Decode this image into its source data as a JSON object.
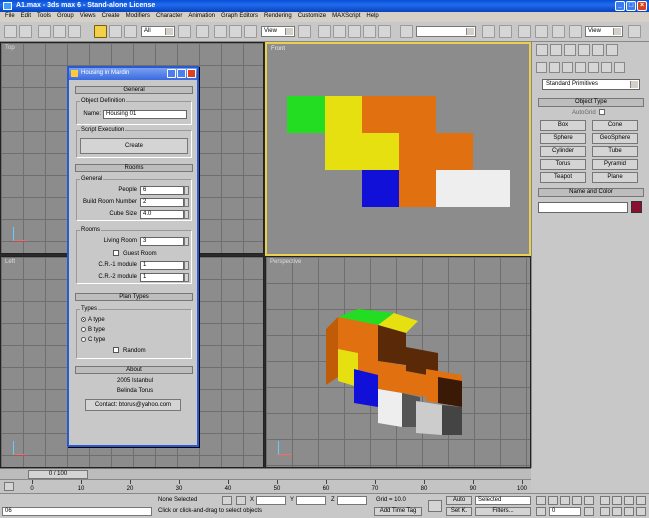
{
  "window": {
    "title": "A1.max - 3ds max 6 - Stand-alone License"
  },
  "menu": [
    "File",
    "Edit",
    "Tools",
    "Group",
    "Views",
    "Create",
    "Modifiers",
    "Character",
    "Animation",
    "Graph Editors",
    "Rendering",
    "Customize",
    "MAXScript",
    "Help"
  ],
  "toolbar": {
    "selection_filter": "All",
    "ref_coord_1": "View",
    "ref_coord_2": "View"
  },
  "viewports": {
    "top": {
      "label": "Top"
    },
    "front": {
      "label": "Front"
    },
    "left": {
      "label": "Left"
    },
    "perspective": {
      "label": "Perspective"
    }
  },
  "colors": {
    "green": "#22dd22",
    "yellow": "#e6e010",
    "orange": "#e07010",
    "blue": "#1010d8",
    "white": "#eeeeee",
    "active_border": "#e8d050"
  },
  "dialog": {
    "title": "Housing in Mardin",
    "general_header": "General",
    "object_definition_title": "Object Definition",
    "name_label": "Name:",
    "name_value": "Housing 01",
    "script_execution_title": "Script Execution",
    "create_button": "Create",
    "rooms_header": "Rooms",
    "general_group_title": "General",
    "people_label": "People",
    "people_value": "6",
    "build_room_label": "Build Room Number",
    "build_room_value": "2",
    "cube_size_label": "Cube Size",
    "cube_size_value": "4.0",
    "rooms_group_title": "Rooms",
    "living_room_label": "Living Room",
    "living_room_value": "3",
    "guest_room_label": "Guest Room",
    "cr1_label": "C.R.-1 module",
    "cr1_value": "1",
    "cr2_label": "C.R.-2 module",
    "cr2_value": "1",
    "plan_types_header": "Plan Types",
    "types_group_title": "Types",
    "type_a": "A type",
    "type_b": "B type",
    "type_c": "C type",
    "random_label": "Random",
    "about_header": "About",
    "about_line1": "2005 Istanbul",
    "about_line2": "Belinda Torus",
    "contact_button": "Contact: btorus@yahoo.com"
  },
  "command_panel": {
    "category": "Standard Primitives",
    "object_type_header": "Object Type",
    "autogrid_label": "AutoGrid",
    "buttons": [
      "Box",
      "Cone",
      "Sphere",
      "GeoSphere",
      "Cylinder",
      "Tube",
      "Torus",
      "Pyramid",
      "Teapot",
      "Plane"
    ],
    "name_color_header": "Name and Color",
    "swatch_color": "#8a1030"
  },
  "timeline": {
    "frame_label": "0 / 100"
  },
  "trackbar": {
    "ticks": [
      "0",
      "10",
      "20",
      "30",
      "40",
      "50",
      "60",
      "70",
      "80",
      "90",
      "100"
    ]
  },
  "status": {
    "selection": "None Selected",
    "prompt": "Click or click-and-drag to select objects",
    "x_label": "X",
    "y_label": "Y",
    "z_label": "Z",
    "grid": "Grid = 10.0",
    "add_time_tag": "Add Time Tag",
    "auto_key": "Auto",
    "set_key": "Set K.",
    "key_mode": "Selected",
    "filters": "Filters...",
    "frame_value": "0",
    "script_value": "06"
  }
}
